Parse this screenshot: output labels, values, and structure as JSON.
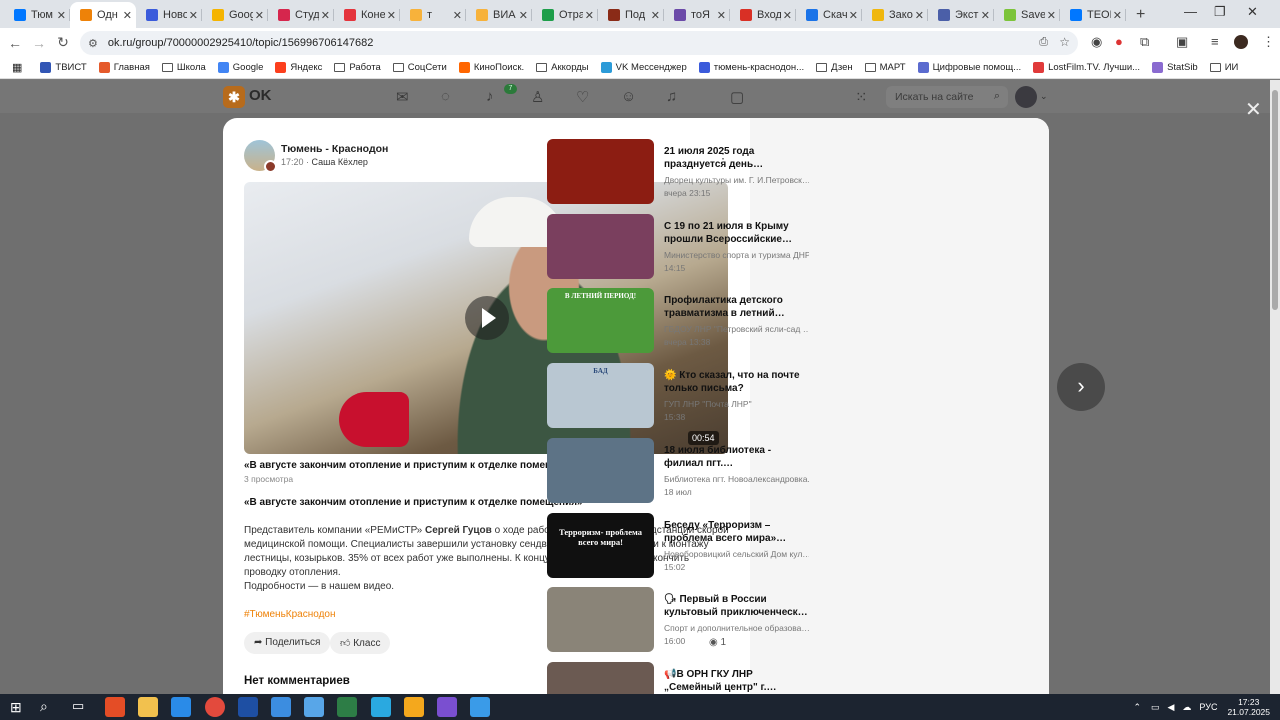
{
  "browser": {
    "tabs": [
      {
        "title": "Тюм",
        "color": "#0077ff"
      },
      {
        "title": "Одн",
        "color": "#ee8208",
        "active": true
      },
      {
        "title": "Ново",
        "color": "#3b5bdb"
      },
      {
        "title": "Goog",
        "color": "#f5b400"
      },
      {
        "title": "Студ",
        "color": "#d6264d"
      },
      {
        "title": "Коне",
        "color": "#e4343c"
      },
      {
        "title": "т",
        "color": "#f7b23b"
      },
      {
        "title": "ВИА",
        "color": "#f7b23b"
      },
      {
        "title": "Отра",
        "color": "#1e9e4a"
      },
      {
        "title": "Под",
        "color": "#8a2b17"
      },
      {
        "title": "тоЯ",
        "color": "#6b4aa8"
      },
      {
        "title": "Вход",
        "color": "#d93025"
      },
      {
        "title": "Скач",
        "color": "#1a73e8"
      },
      {
        "title": "Зако",
        "color": "#f0b70d"
      },
      {
        "title": "Экст",
        "color": "#4b5fa8"
      },
      {
        "title": "Savef",
        "color": "#7cc43a"
      },
      {
        "title": "ТЕОР",
        "color": "#0077ff"
      }
    ],
    "new_tab_glyph": "+",
    "url": "ok.ru/group/70000002925410/topic/156996706147682"
  },
  "bookmarks": [
    {
      "label": "ТВИСТ",
      "kind": "icon",
      "color": "#3256b5"
    },
    {
      "label": "Главная",
      "kind": "icon",
      "color": "#e55a2b"
    },
    {
      "label": "Школа",
      "kind": "folder"
    },
    {
      "label": "Google",
      "kind": "icon",
      "color": "#4285f4"
    },
    {
      "label": "Яндекс",
      "kind": "icon",
      "color": "#fc3f1d"
    },
    {
      "label": "Работа",
      "kind": "folder"
    },
    {
      "label": "СоцСети",
      "kind": "folder"
    },
    {
      "label": "КиноПоиск.",
      "kind": "icon",
      "color": "#ff6600"
    },
    {
      "label": "Аккорды",
      "kind": "folder"
    },
    {
      "label": "VK Мессенджер",
      "kind": "icon",
      "color": "#2c9bd8"
    },
    {
      "label": "тюмень-краснодон...",
      "kind": "icon",
      "color": "#3b5bdb"
    },
    {
      "label": "Дзен",
      "kind": "folder"
    },
    {
      "label": "МАРТ",
      "kind": "folder"
    },
    {
      "label": "Цифровые помощ...",
      "kind": "icon",
      "color": "#5b6bcf"
    },
    {
      "label": "LostFilm.TV. Лучши...",
      "kind": "icon",
      "color": "#e03a3a"
    },
    {
      "label": "StatSib",
      "kind": "icon",
      "color": "#8a6bd0"
    },
    {
      "label": "ИИ",
      "kind": "folder"
    }
  ],
  "ok": {
    "logo_text": "OK",
    "notif_count": "7",
    "search_placeholder": "Искать на сайте"
  },
  "post": {
    "group_name": "Тюмень - Краснодон",
    "time": "17:20",
    "author": "Саша Кёхлер",
    "video_duration": "00:54",
    "video_title": "«В августе закончим отопление и приступим к отделке помещения»",
    "views_text": "3 просмотра",
    "title": "«В августе закончим отопление и приступим к отделке помещения»",
    "body_before": "Представитель компании «РЕМиСТР» ",
    "body_bold": "Сергей Гуцов",
    "body_after": " о ходе работ по строительству подстанции скорой медицинской помощи. Специалисты завершили установку сендвич-панелей, приступили к монтажу лестницы, козырьков. 35% от всех работ уже выполнены. К концу августа планируют закончить проводку отопления.",
    "more_text": "Подробности — в нашем видео.",
    "hashtag": "#ТюменьКраснодон",
    "share_label": "Поделиться",
    "like_label": "Класс",
    "view_count": "1",
    "comments_heading": "Нет комментариев"
  },
  "feed": [
    {
      "title": "21 июля 2025 года празднуется день…",
      "source": "Дворец культуры им. Г. И.Петровск…",
      "date": "вчера 23:15",
      "thumb": "#8c1d12"
    },
    {
      "title": "С 19 по 21 июля в Крыму прошли Всероссийские…",
      "source": "Министерство спорта и туризма ДНР",
      "date": "14:15",
      "thumb": "#7a3f5e"
    },
    {
      "title": "Профилактика детского травматизма в летний…",
      "source": "ГБДОУ ЛНР \"Петровский ясли-сад …",
      "date": "вчера 13:38",
      "thumb": "#4c9a3a",
      "thumb_text": "В ЛЕТНИЙ ПЕРИОД!"
    },
    {
      "title": "🌞 Кто сказал, что на почте только письма?",
      "source": "ГУП ЛНР \"Почта ЛНР\"",
      "date": "15:38",
      "thumb": "#b9c7d2",
      "thumb_text": "БАД"
    },
    {
      "title": "18 июля библиотека - филиал пгт.…",
      "source": "Библиотека пгт. Новоалександровка.",
      "date": "18 июл",
      "thumb": "#5d7386"
    },
    {
      "title": "Беседу «Терроризм – проблема всего мира»…",
      "source": "Новоборовицкий сельский Дом кул…",
      "date": "15:02",
      "thumb": "#101010",
      "thumb_text": "Терроризм- проблема всего мира!"
    },
    {
      "title": "🗣 Первый в России культовый приключенческ…",
      "source": "Спорт и дополнительное образова…",
      "date": "16:00",
      "thumb": "#8a8478"
    },
    {
      "title": "📢В ОРН ГКУ ЛНР „Семейный центр\" г.…",
      "source": "",
      "date": "",
      "thumb": "#6b5a52"
    }
  ],
  "taskbar": {
    "lang": "РУС",
    "time": "17:23",
    "date": "21.07.2025",
    "apps": [
      "#e44d26",
      "#f2c14e",
      "#2a8be8",
      "#e34a3d",
      "#1e4fa3",
      "#3c8de0",
      "#58a6e8",
      "#2d7d46",
      "#2aa9e0",
      "#f4a81d",
      "#7a4fd0",
      "#3a9be8"
    ]
  }
}
